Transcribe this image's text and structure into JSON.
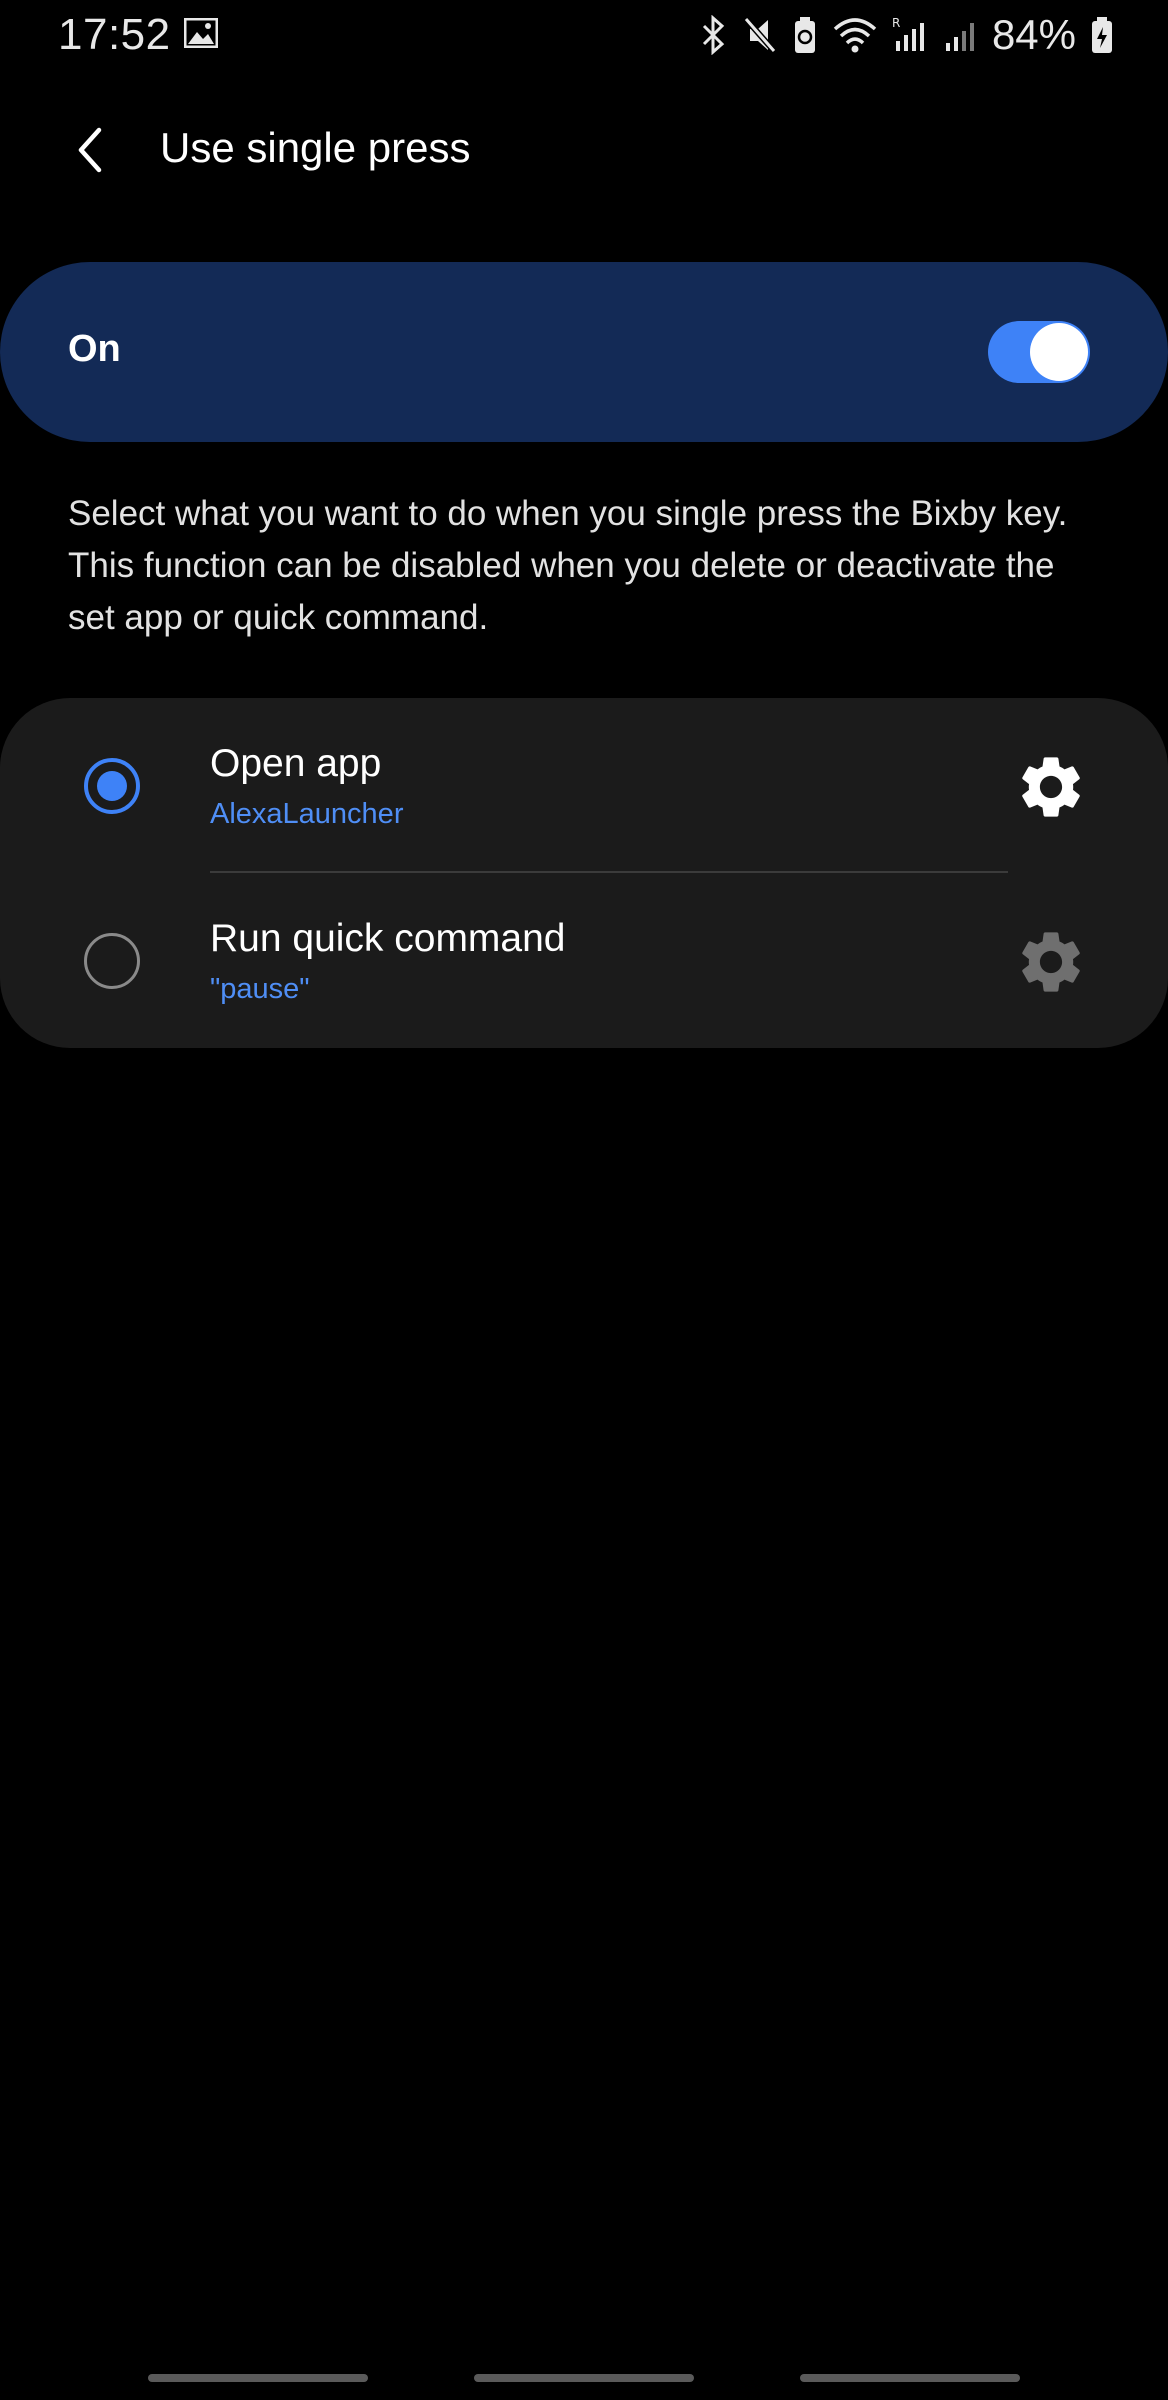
{
  "status_bar": {
    "time": "17:52",
    "battery_percent": "84%",
    "icons": [
      "gallery-icon",
      "bluetooth-icon",
      "mute-icon",
      "battery-saver-icon",
      "wifi-icon",
      "signal-icon",
      "signal-2-icon",
      "battery-charging-icon"
    ]
  },
  "header": {
    "title": "Use single press",
    "back_icon": "back-arrow-icon"
  },
  "master_switch": {
    "label": "On",
    "checked": true,
    "accent_color": "#3e82f7",
    "card_color": "#132a56"
  },
  "description": "Select what you want to do when you single press the Bixby key. This function can be disabled when you delete or deactivate the set app or quick command.",
  "options": [
    {
      "title": "Open app",
      "subtitle": "AlexaLauncher",
      "selected": true,
      "settings_icon": "gear-icon",
      "settings_enabled": true
    },
    {
      "title": "Run quick command",
      "subtitle": "\"pause\"",
      "selected": false,
      "settings_icon": "gear-icon",
      "settings_enabled": false
    }
  ],
  "colors": {
    "background": "#000000",
    "link": "#4f8ef5",
    "card": "#1b1b1b"
  }
}
